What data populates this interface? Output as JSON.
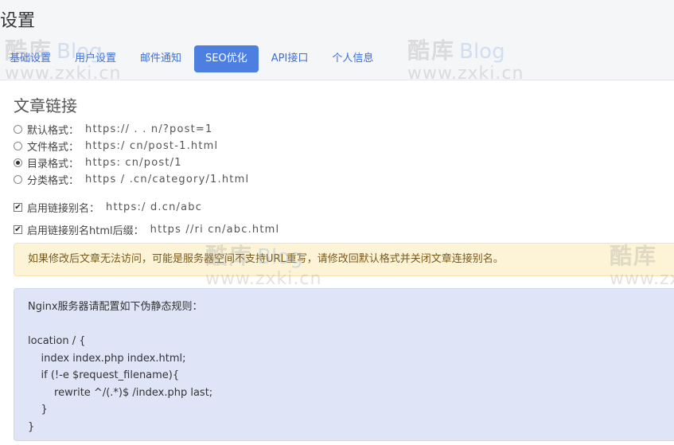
{
  "page": {
    "title": "设置"
  },
  "tabs": [
    {
      "label": "基础设置"
    },
    {
      "label": "用户设置"
    },
    {
      "label": "邮件通知"
    },
    {
      "label": "SEO优化"
    },
    {
      "label": "API接口"
    },
    {
      "label": "个人信息"
    }
  ],
  "section": {
    "title": "文章链接"
  },
  "link_formats": [
    {
      "label": "默认格式：",
      "url": "https://  .  .  n/?post=1",
      "checked": false
    },
    {
      "label": "文件格式：",
      "url": "https:/  cn/post-1.html",
      "checked": false
    },
    {
      "label": "目录格式：",
      "url": "https:  cn/post/1",
      "checked": true
    },
    {
      "label": "分类格式：",
      "url": "https /  .cn/category/1.html",
      "checked": false
    }
  ],
  "options": [
    {
      "label": "启用链接别名：",
      "url": "https:/  d.cn/abc",
      "checked": true
    },
    {
      "label": "启用链接别名html后缀：",
      "url": "https //ri  cn/abc.html",
      "checked": true
    }
  ],
  "alert": {
    "text": "如果修改后文章无法访问，可能是服务器空间不支持URL重写，请修改回默认格式并关闭文章连接别名。"
  },
  "rules": {
    "lines": [
      "Nginx服务器请配置如下伪静态规则：",
      "",
      "location / {",
      "    index index.php index.html;",
      "    if (!-e $request_filename){",
      "        rewrite ^/(.*)$ /index.php last;",
      "    }",
      "}"
    ]
  },
  "watermark": {
    "brand": "酷库",
    "blog": "Blog",
    "url": "www.zxki.cn"
  }
}
